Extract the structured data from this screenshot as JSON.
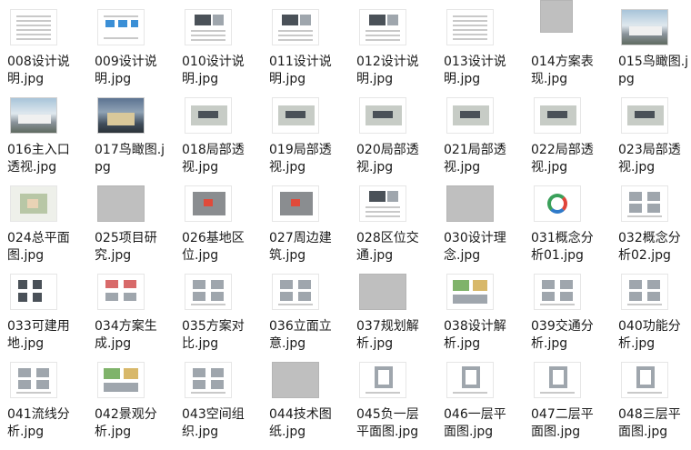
{
  "files": [
    {
      "name": "008设计说明.jpg",
      "thumb": "doc"
    },
    {
      "name": "009设计说明.jpg",
      "thumb": "doc-blue"
    },
    {
      "name": "010设计说明.jpg",
      "thumb": "doc-img"
    },
    {
      "name": "011设计说明.jpg",
      "thumb": "doc-img"
    },
    {
      "name": "012设计说明.jpg",
      "thumb": "doc-img"
    },
    {
      "name": "013设计说明.jpg",
      "thumb": "doc"
    },
    {
      "name": "014方案表现.jpg",
      "thumb": "grey-tall"
    },
    {
      "name": "015鸟瞰图.jpg",
      "thumb": "photo"
    },
    {
      "name": "016主入口透视.jpg",
      "thumb": "photo"
    },
    {
      "name": "017鸟瞰图.jpg",
      "thumb": "night"
    },
    {
      "name": "018局部透视.jpg",
      "thumb": "render"
    },
    {
      "name": "019局部透视.jpg",
      "thumb": "render"
    },
    {
      "name": "020局部透视.jpg",
      "thumb": "render"
    },
    {
      "name": "021局部透视.jpg",
      "thumb": "render"
    },
    {
      "name": "022局部透视.jpg",
      "thumb": "render"
    },
    {
      "name": "023局部透视.jpg",
      "thumb": "render"
    },
    {
      "name": "024总平面图.jpg",
      "thumb": "site"
    },
    {
      "name": "025项目研究.jpg",
      "thumb": "grey"
    },
    {
      "name": "026基地区位.jpg",
      "thumb": "map"
    },
    {
      "name": "027周边建筑.jpg",
      "thumb": "map"
    },
    {
      "name": "028区位交通.jpg",
      "thumb": "doc-img"
    },
    {
      "name": "030设计理念.jpg",
      "thumb": "grey"
    },
    {
      "name": "031概念分析01.jpg",
      "thumb": "ring"
    },
    {
      "name": "032概念分析02.jpg",
      "thumb": "diagram"
    },
    {
      "name": "033可建用地.jpg",
      "thumb": "diagram-dark"
    },
    {
      "name": "034方案生成.jpg",
      "thumb": "diagram-red"
    },
    {
      "name": "035方案对比.jpg",
      "thumb": "diagram"
    },
    {
      "name": "036立面立意.jpg",
      "thumb": "diagram"
    },
    {
      "name": "037规划解析.jpg",
      "thumb": "grey"
    },
    {
      "name": "038设计解析.jpg",
      "thumb": "diagram-color"
    },
    {
      "name": "039交通分析.jpg",
      "thumb": "diagram"
    },
    {
      "name": "040功能分析.jpg",
      "thumb": "diagram"
    },
    {
      "name": "041流线分析.jpg",
      "thumb": "diagram"
    },
    {
      "name": "042景观分析.jpg",
      "thumb": "diagram-color"
    },
    {
      "name": "043空间组织.jpg",
      "thumb": "diagram"
    },
    {
      "name": "044技术图纸.jpg",
      "thumb": "grey"
    },
    {
      "name": "045负一层平面图.jpg",
      "thumb": "plan"
    },
    {
      "name": "046一层平面图.jpg",
      "thumb": "plan"
    },
    {
      "name": "047二层平面图.jpg",
      "thumb": "plan"
    },
    {
      "name": "048三层平面图.jpg",
      "thumb": "plan"
    }
  ]
}
